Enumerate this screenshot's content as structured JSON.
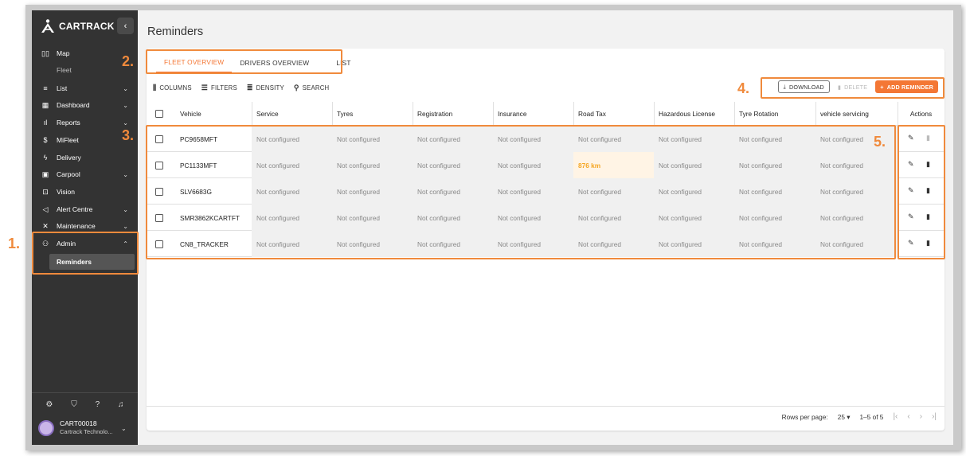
{
  "app": {
    "logo_text": "CARTRACK",
    "collapse_icon": "chevron-left-icon"
  },
  "sidebar": {
    "items": [
      {
        "label": "Map",
        "icon": "map-icon"
      },
      {
        "label": "List",
        "icon": "list-icon"
      },
      {
        "label": "Dashboard",
        "icon": "dashboard-icon"
      },
      {
        "label": "Reports",
        "icon": "reports-icon"
      },
      {
        "label": "MiFleet",
        "icon": "dollar-icon"
      },
      {
        "label": "Delivery",
        "icon": "bolt-icon"
      },
      {
        "label": "Carpool",
        "icon": "calendar-icon"
      },
      {
        "label": "Vision",
        "icon": "video-icon"
      },
      {
        "label": "Alert Centre",
        "icon": "megaphone-icon"
      },
      {
        "label": "Maintenance",
        "icon": "tools-icon"
      },
      {
        "label": "Admin",
        "icon": "admin-icon"
      }
    ],
    "map_sub": "Fleet",
    "admin_sub_active": "Reminders",
    "footer_icons": [
      "settings-icon",
      "shield-icon",
      "help-icon",
      "bell-icon"
    ],
    "user": {
      "name": "CART00018",
      "org": "Cartrack Technolo..."
    }
  },
  "page": {
    "title": "Reminders"
  },
  "tabs": [
    "FLEET OVERVIEW",
    "DRIVERS OVERVIEW",
    "LIST"
  ],
  "toolbar": {
    "columns": "COLUMNS",
    "filters": "FILTERS",
    "density": "DENSITY",
    "search": "SEARCH"
  },
  "actions": {
    "download": "DOWNLOAD",
    "delete": "DELETE",
    "add": "ADD REMINDER"
  },
  "table": {
    "headers": [
      "Vehicle",
      "Service",
      "Tyres",
      "Registration",
      "Insurance",
      "Road Tax",
      "Hazardous License",
      "Tyre Rotation",
      "vehicle servicing",
      "Actions"
    ],
    "rows": [
      {
        "vehicle": "PC9658MFT",
        "cells": [
          "Not configured",
          "Not configured",
          "Not configured",
          "Not configured",
          "Not configured",
          "Not configured",
          "Not configured",
          "Not configured"
        ]
      },
      {
        "vehicle": "PC1133MFT",
        "cells": [
          "Not configured",
          "Not configured",
          "Not configured",
          "Not configured",
          "876 km",
          "Not configured",
          "Not configured",
          "Not configured"
        ]
      },
      {
        "vehicle": "SLV6683G",
        "cells": [
          "Not configured",
          "Not configured",
          "Not configured",
          "Not configured",
          "Not configured",
          "Not configured",
          "Not configured",
          "Not configured"
        ]
      },
      {
        "vehicle": "SMR3862KCARTFT",
        "cells": [
          "Not configured",
          "Not configured",
          "Not configured",
          "Not configured",
          "Not configured",
          "Not configured",
          "Not configured",
          "Not configured"
        ]
      },
      {
        "vehicle": "CN8_TRACKER",
        "cells": [
          "Not configured",
          "Not configured",
          "Not configured",
          "Not configured",
          "Not configured",
          "Not configured",
          "Not configured",
          "Not configured"
        ]
      }
    ]
  },
  "pagination": {
    "rows_per_page_label": "Rows per page:",
    "rows_per_page_value": "25",
    "range": "1–5 of 5"
  },
  "annotations": [
    "1.",
    "2.",
    "3.",
    "4.",
    "5."
  ],
  "colors": {
    "accent": "#f47735",
    "annotation": "#f08a3c",
    "sidebar": "#333333",
    "warning_text": "#f5a623"
  }
}
